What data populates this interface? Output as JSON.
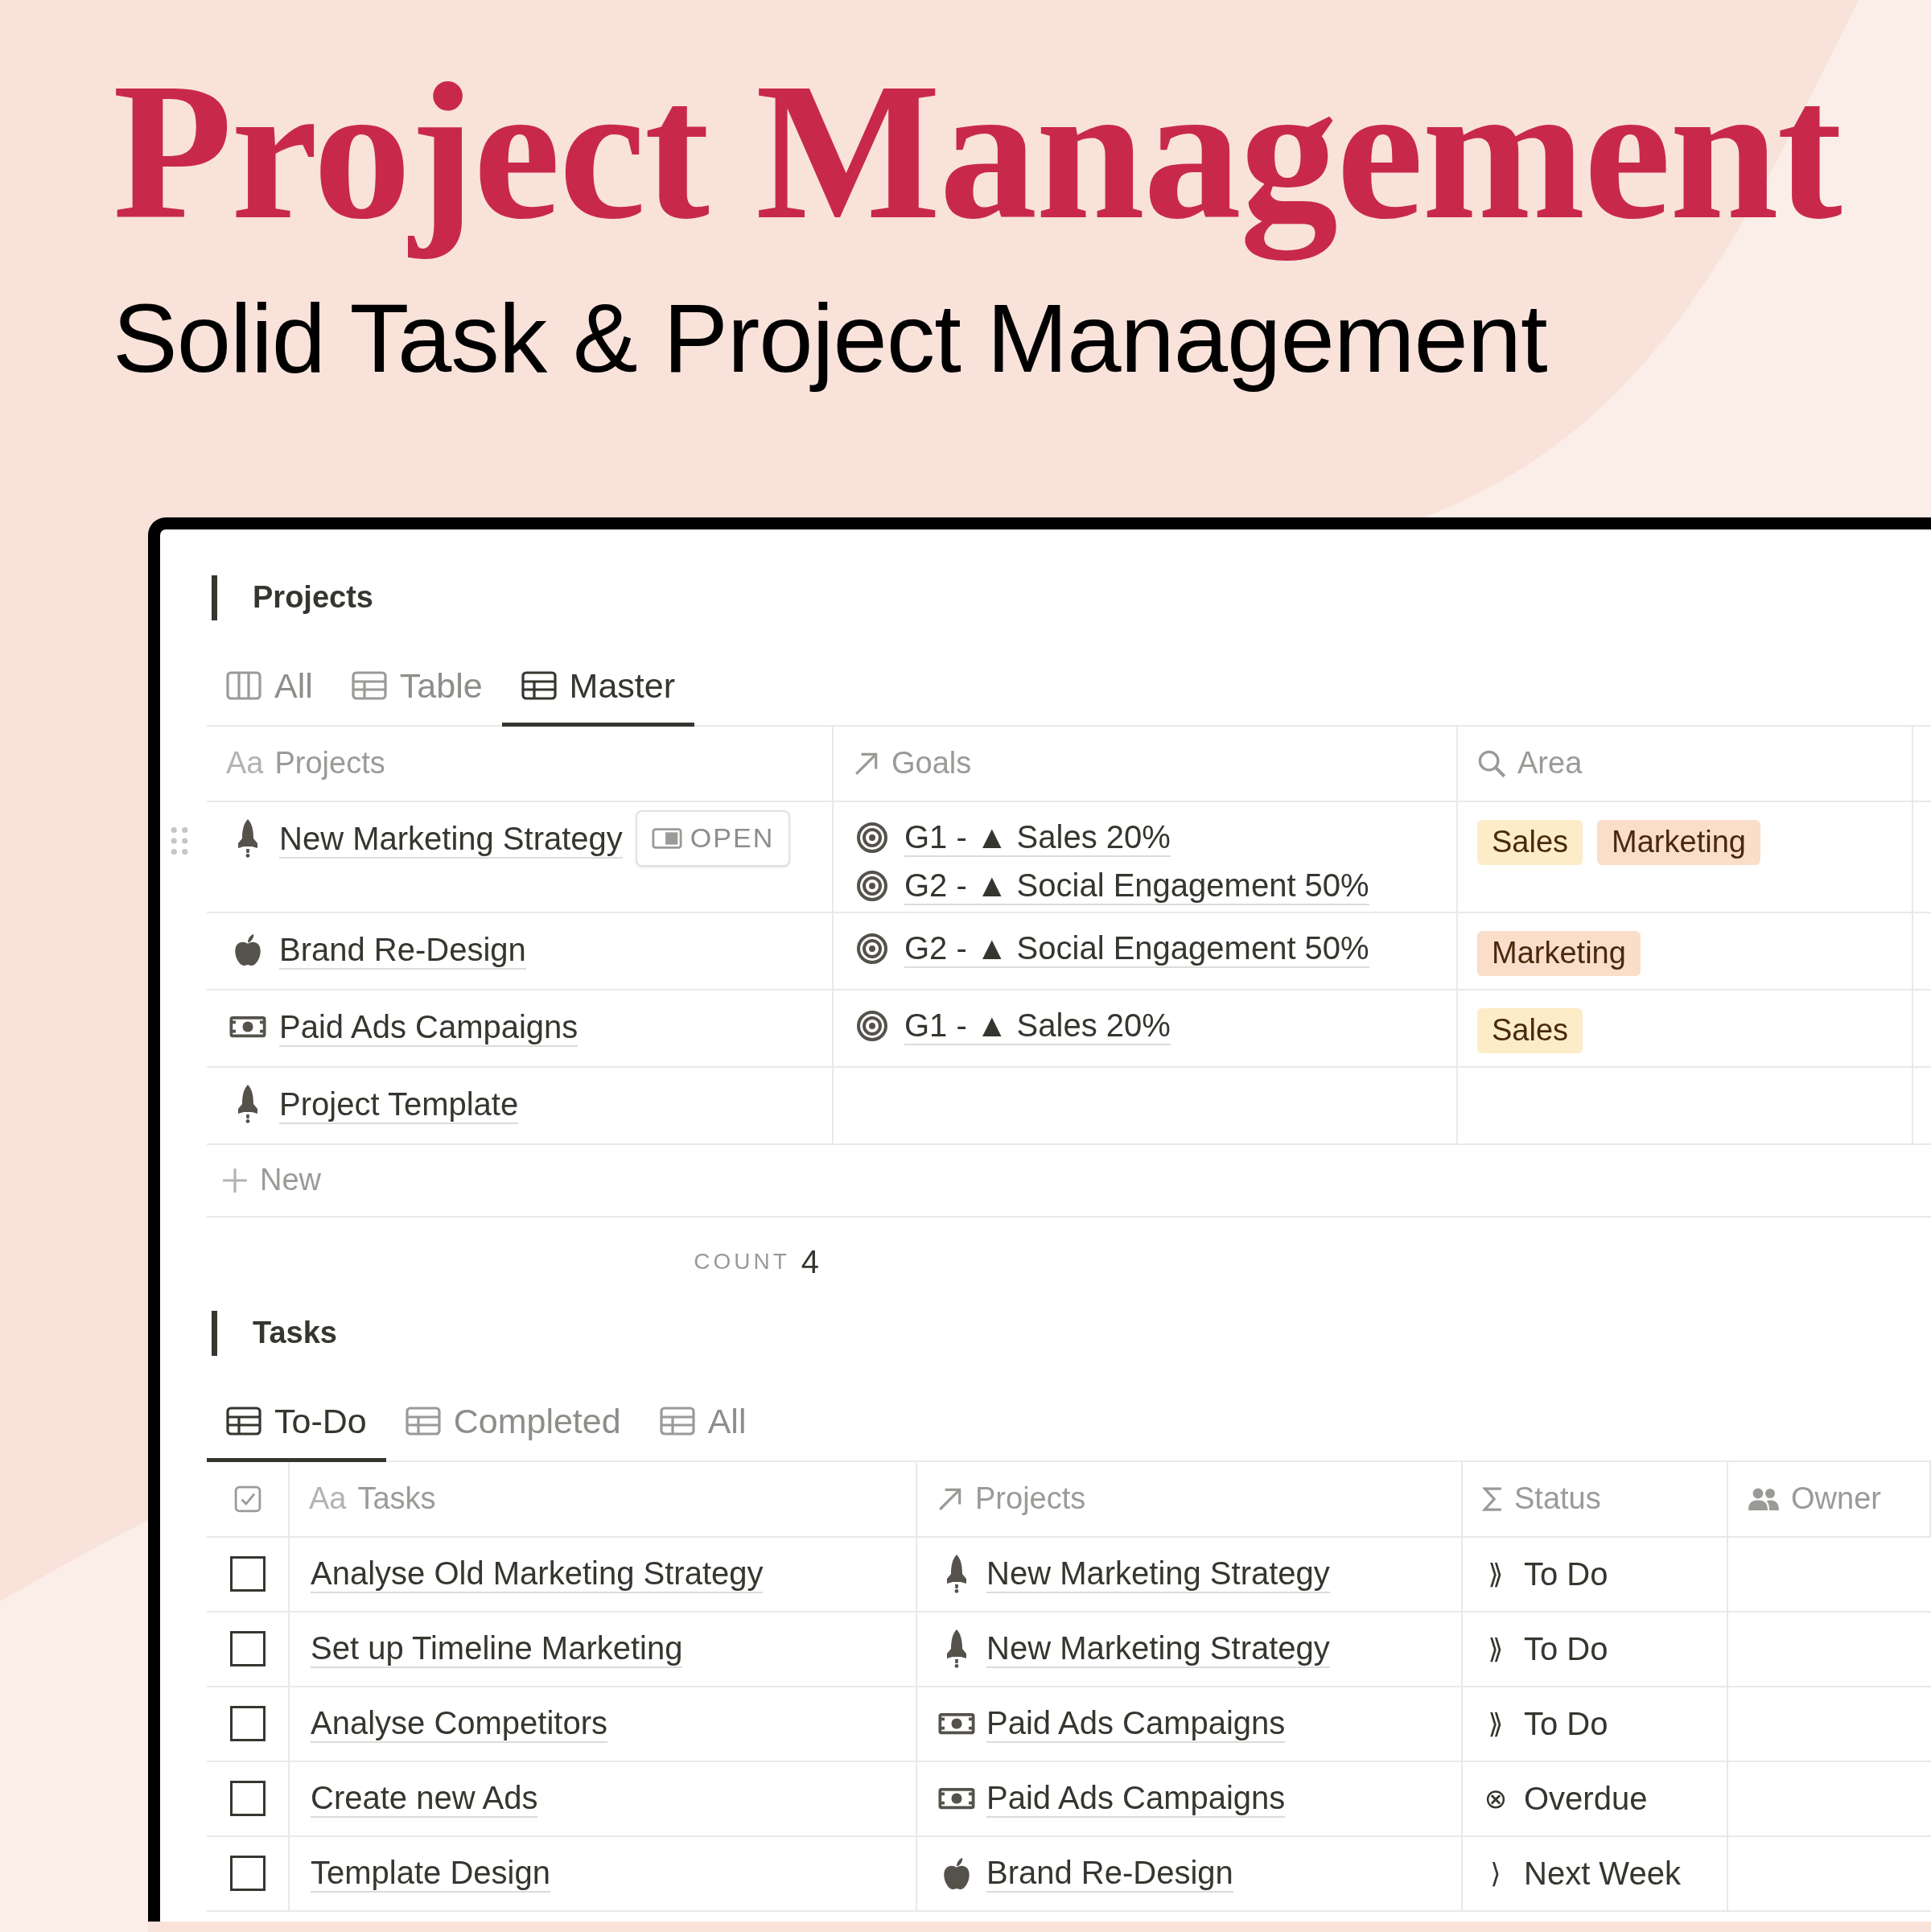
{
  "header": {
    "title": "Project Management",
    "subtitle": "Solid Task & Project Management"
  },
  "projects": {
    "heading": "Projects",
    "tabs": [
      {
        "kind": "board",
        "label": "All",
        "selected": false
      },
      {
        "kind": "table",
        "label": "Table",
        "selected": false
      },
      {
        "kind": "table",
        "label": "Master",
        "selected": true
      }
    ],
    "columns": [
      {
        "kind": "title",
        "prefix": "Aa",
        "label": "Projects"
      },
      {
        "kind": "relation",
        "label": "Goals"
      },
      {
        "kind": "search",
        "label": "Area"
      }
    ],
    "rows": [
      {
        "kind": "rocket",
        "name": "New Marketing Strategy",
        "open_button": "OPEN",
        "goals": [
          "G1 - ▲ Sales 20%",
          "G2 - ▲ Social Engagement 50%"
        ],
        "areas": [
          {
            "label": "Sales",
            "color": "#fdecc8"
          },
          {
            "label": "Marketing",
            "color": "#fadec9"
          }
        ]
      },
      {
        "kind": "apple",
        "name": "Brand Re-Design",
        "goals": [
          "G2 - ▲ Social Engagement 50%"
        ],
        "areas": [
          {
            "label": "Marketing",
            "color": "#fadec9"
          }
        ]
      },
      {
        "kind": "money",
        "name": "Paid Ads Campaigns",
        "goals": [
          "G1 - ▲ Sales 20%"
        ],
        "areas": [
          {
            "label": "Sales",
            "color": "#fdecc8"
          }
        ]
      },
      {
        "kind": "rocket",
        "name": "Project Template"
      }
    ],
    "new_label": "New",
    "count_label": "COUNT",
    "count": "4"
  },
  "tasks": {
    "heading": "Tasks",
    "tabs": [
      {
        "kind": "table",
        "label": "To-Do",
        "selected": true
      },
      {
        "kind": "table",
        "label": "Completed",
        "selected": false
      },
      {
        "kind": "table",
        "label": "All",
        "selected": false
      }
    ],
    "columns": [
      {
        "kind": "checkbox"
      },
      {
        "kind": "title",
        "prefix": "Aa",
        "label": "Tasks"
      },
      {
        "kind": "relation",
        "label": "Projects"
      },
      {
        "kind": "formula",
        "label": "Status"
      },
      {
        "kind": "person",
        "label": "Owner"
      }
    ],
    "rows": [
      {
        "checked": false,
        "task": "Analyse Old Marketing Strategy",
        "project": {
          "kind": "rocket",
          "name": "New Marketing Strategy"
        },
        "status": {
          "symbol": "⟫",
          "label": "To Do"
        }
      },
      {
        "checked": false,
        "task": "Set up Timeline Marketing",
        "project": {
          "kind": "rocket",
          "name": "New Marketing Strategy"
        },
        "status": {
          "symbol": "⟫",
          "label": "To Do"
        }
      },
      {
        "checked": false,
        "task": "Analyse Competitors",
        "project": {
          "kind": "money",
          "name": "Paid Ads Campaigns"
        },
        "status": {
          "symbol": "⟫",
          "label": "To Do"
        }
      },
      {
        "checked": false,
        "task": "Create new Ads",
        "project": {
          "kind": "money",
          "name": "Paid Ads Campaigns"
        },
        "status": {
          "symbol": "⊗",
          "label": "Overdue"
        }
      },
      {
        "checked": false,
        "task": "Template Design",
        "project": {
          "kind": "apple",
          "name": "Brand Re-Design"
        },
        "status": {
          "symbol": "⟩",
          "label": "Next Week"
        }
      }
    ]
  }
}
